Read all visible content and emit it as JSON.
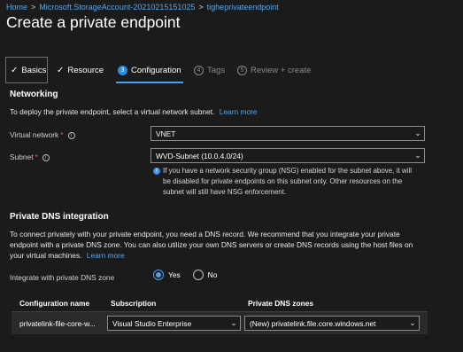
{
  "breadcrumb": {
    "items": [
      "Home",
      "Microsoft.StorageAccount-20210215151025",
      "tigheprivateendpoint"
    ],
    "separator": ">"
  },
  "page": {
    "title": "Create a private endpoint"
  },
  "tabs": [
    {
      "label": "Basics",
      "state": "completed",
      "icon": "check-icon"
    },
    {
      "label": "Resource",
      "state": "completed",
      "icon": "check-icon"
    },
    {
      "label": "Configuration",
      "state": "active",
      "number": "3"
    },
    {
      "label": "Tags",
      "state": "disabled",
      "number": "4"
    },
    {
      "label": "Review + create",
      "state": "disabled",
      "number": "5"
    }
  ],
  "networking": {
    "heading": "Networking",
    "description": "To deploy the private endpoint, select a virtual network subnet.",
    "learn_more": "Learn more",
    "virtual_network": {
      "label": "Virtual network",
      "required": "*",
      "value": "VNET"
    },
    "subnet": {
      "label": "Subnet",
      "required": "*",
      "value": "WVD-Subnet (10.0.4.0/24)"
    },
    "nsg_note": [
      "If you have a network security group (NSG) enabled for the subnet above, it will",
      "be disabled for private endpoints on this subnet only. Other resources on the",
      "subnet will still have NSG enforcement."
    ]
  },
  "dns": {
    "heading": "Private DNS integration",
    "description": [
      "To connect privately with your private endpoint, you need a DNS record. We recommend that you integrate your private",
      "endpoint with a private DNS zone. You can also utilize your own DNS servers or create DNS records using the host files on",
      "your virtual machines."
    ],
    "learn_more": "Learn more",
    "integrate_label": "Integrate with private DNS zone",
    "options": [
      "Yes",
      "No"
    ],
    "selected": "Yes",
    "table": {
      "headers": [
        "Configuration name",
        "Subscription",
        "Private DNS zones"
      ],
      "rows": [
        {
          "configuration_name": "privatelink-file-core-w...",
          "subscription": "Visual Studio Enterprise",
          "private_dns_zone": "(New) privatelink.file.core.windows.net"
        }
      ]
    }
  },
  "colors": {
    "background": "#1b1b1b",
    "link": "#59a5e8",
    "accent": "#4aa0ec",
    "required": "#f25b5b"
  }
}
